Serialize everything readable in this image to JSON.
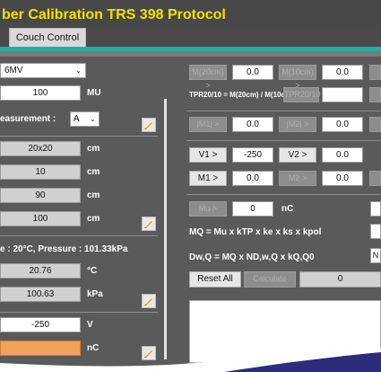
{
  "title": "ber Calibration TRS 398 Protocol",
  "tab": "Couch Control",
  "left": {
    "energy": "6MV",
    "mu_value": "100",
    "mu_unit": "MU",
    "measurement_label": "easurement :",
    "measurement_value": "A",
    "field_size": "20x20",
    "depth": "10",
    "ssd": "90",
    "ref_depth": "100",
    "cm": "cm",
    "conditions": "e : 20°C, Pressure : 101.33kPa",
    "temperature": "20.76",
    "temp_unit": "°C",
    "pressure": "100.63",
    "pressure_unit": "kPa",
    "voltage": "-250",
    "voltage_unit": "V",
    "charge": "",
    "charge_unit": "nC"
  },
  "right": {
    "m_20": "M(20cm) >",
    "m_20_val": "0.0",
    "m_10": "M(10cm) >",
    "m_10_val": "0.0",
    "tpr_formula": "TPR20/10 = M(20cm) / M(10cm)",
    "tpr_btn": "TPR20/10",
    "m1_top": "|M1| >",
    "m1_top_val": "0.0",
    "m2_top": "|M2| >",
    "m2_top_val": "0.0",
    "v1_btn": "V1 >",
    "v1_val": "-250",
    "v2_btn": "V2 >",
    "v2_val": "0.0",
    "m1_btn": "M1 >",
    "m1_val": "0.0",
    "m2_btn": "M2 >",
    "m2_val": "0.0",
    "mu_btn": "Mu >",
    "mu_val": "0",
    "mu_unit": "nC",
    "formula_mq": "MQ = Mu x kTP x ke x ks x kpol",
    "formula_dw": "Dw,Q = MQ x ND,w,Q x kQ,Q0",
    "reset": "Reset All",
    "calculate": "Calculate",
    "result": "0",
    "side_n": "N"
  },
  "colors": {
    "title": "#f0e200",
    "teal": "#22b0a6",
    "charge_field": "#f4a25a"
  }
}
